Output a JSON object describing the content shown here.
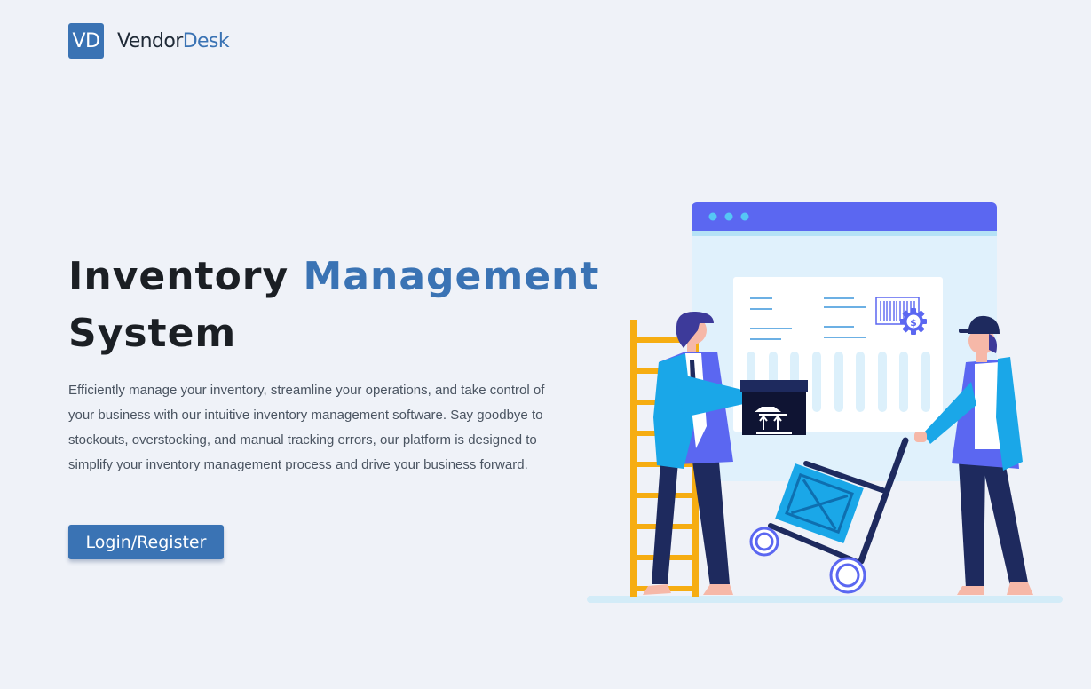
{
  "brand": {
    "logo_text": "VD",
    "name_part1": "Vendor",
    "name_part2": "Desk"
  },
  "hero": {
    "title_part1": "Inventory",
    "title_accent": "Management",
    "title_part2": "System",
    "description": "Efficiently manage your inventory, streamline your operations, and take control of your business with our intuitive inventory management software. Say goodbye to stockouts, overstocking, and manual tracking errors, our platform is designed to simplify your inventory management process and drive your business forward.",
    "cta_label": "Login/Register"
  },
  "colors": {
    "brand": "#3a73b4",
    "background": "#eff2f8",
    "illustration_purple": "#5b67f1",
    "illustration_cyan": "#1aa7e8",
    "ladder": "#f6ad12",
    "navy": "#1e2a5e"
  },
  "illustration": {
    "icons": [
      "browser-window",
      "barcode-icon",
      "dollar-gear-icon",
      "box-icon",
      "hand-truck",
      "ladder"
    ]
  }
}
